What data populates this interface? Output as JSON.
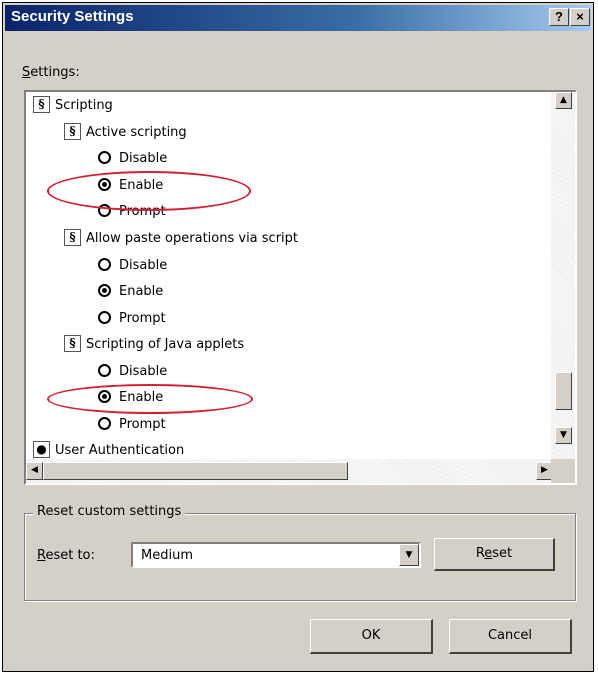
{
  "window": {
    "title": "Security Settings",
    "help_button": "?",
    "close_button": "×"
  },
  "settings": {
    "label_prefix": "S",
    "label_rest": "ettings:",
    "tree": {
      "root": "Scripting",
      "items": [
        {
          "label": "Active scripting",
          "options": [
            {
              "label": "Disable",
              "selected": false
            },
            {
              "label": "Enable",
              "selected": true
            },
            {
              "label": "Prompt",
              "selected": false
            }
          ]
        },
        {
          "label": "Allow paste operations via script",
          "options": [
            {
              "label": "Disable",
              "selected": false
            },
            {
              "label": "Enable",
              "selected": true
            },
            {
              "label": "Prompt",
              "selected": false
            }
          ]
        },
        {
          "label": "Scripting of Java applets",
          "options": [
            {
              "label": "Disable",
              "selected": false
            },
            {
              "label": "Enable",
              "selected": true
            },
            {
              "label": "Prompt",
              "selected": false
            }
          ]
        }
      ],
      "next_root_partial": "User Authentication"
    }
  },
  "reset": {
    "group_title": "Reset custom settings",
    "reset_to_prefix": "R",
    "reset_to_rest": "eset to:",
    "selected_value": "Medium",
    "reset_button_pre": "R",
    "reset_button_ul": "e",
    "reset_button_post": "set"
  },
  "footer": {
    "ok": "OK",
    "cancel": "Cancel"
  },
  "colors": {
    "titlebar_start": "#0a246a",
    "highlight_ellipse": "#d32030"
  },
  "icons": {
    "setting_icon": "script-scroll-icon",
    "radio_empty": "radio-unselected-icon",
    "radio_filled": "radio-selected-icon"
  }
}
